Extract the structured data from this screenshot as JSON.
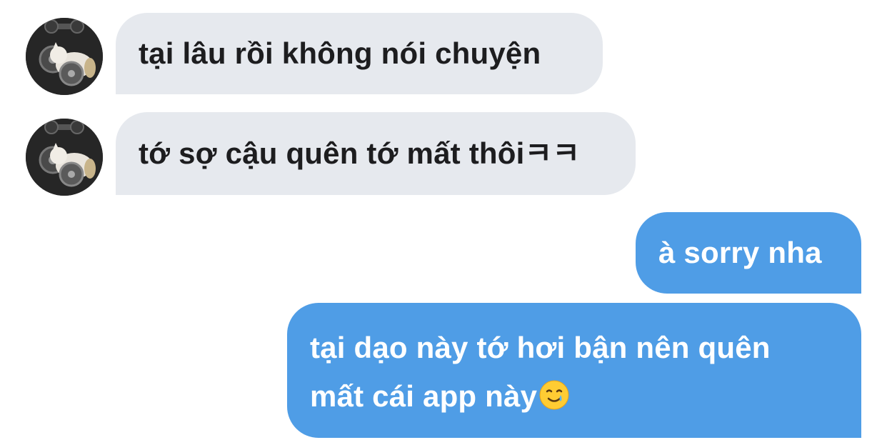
{
  "conversation": {
    "messages": [
      {
        "sender": "other",
        "text": "tại lâu rồi không nói chuyện"
      },
      {
        "sender": "other",
        "text": "tớ sợ cậu quên tớ mất thôiㅋㅋ"
      },
      {
        "sender": "me",
        "text": "à sorry nha"
      },
      {
        "sender": "me",
        "line1": "tại dạo này tớ hơi bận nên quên",
        "line2": "mất cái app này",
        "emoji": "smiling-face-with-tear"
      }
    ]
  },
  "colors": {
    "incoming_bubble": "#e6e9ee",
    "outgoing_bubble": "#4f9de6",
    "incoming_text": "#1d1d1f",
    "outgoing_text": "#ffffff"
  },
  "icons": {
    "avatar": "cat-with-weights-photo",
    "emoji": "smiling-face-with-tear-icon"
  }
}
